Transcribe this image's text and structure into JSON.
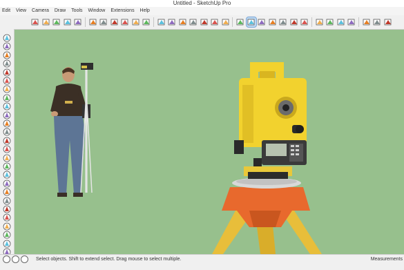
{
  "window": {
    "title": "Untitled - SketchUp Pro"
  },
  "menu": [
    "Edit",
    "View",
    "Camera",
    "Draw",
    "Tools",
    "Window",
    "Extensions",
    "Help"
  ],
  "toolbar": {
    "icons": [
      "select-icon",
      "paint-bucket-icon",
      "eraser-icon",
      "move-icon",
      "rotate-icon",
      "offset-icon",
      "push-pull-icon",
      "follow-me-icon",
      "orbit-icon",
      "pan-icon",
      "zoom-icon",
      "zoom-extents-icon",
      "iso-view-icon",
      "top-view-icon",
      "front-view-icon",
      "right-view-icon",
      "back-view-icon",
      "left-view-icon",
      "x-ray-icon",
      "back-edges-icon",
      "wireframe-icon",
      "hidden-line-icon",
      "shaded-icon",
      "textured-icon",
      "monochrome-icon",
      "cloud-icon",
      "cloud-download-icon",
      "cloud-upload-icon",
      "extension-warehouse-icon",
      "section-plane-icon",
      "section-display-icon",
      "section-cut-icon"
    ]
  },
  "left_toolbar": {
    "icons": [
      "select-icon",
      "eraser-icon",
      "line-icon",
      "freehand-icon",
      "rectangle-icon",
      "circle-icon",
      "arc-icon",
      "polygon-icon",
      "move-icon",
      "push-pull-icon",
      "rotate-icon",
      "scale-icon",
      "follow-me-icon",
      "offset-icon",
      "tape-measure-icon",
      "dimension-icon",
      "protractor-icon",
      "text-icon",
      "axes-icon",
      "3d-text-icon",
      "paint-bucket-icon",
      "orbit-icon",
      "pan-icon",
      "zoom-icon",
      "walk-icon",
      "position-camera-icon"
    ]
  },
  "viewport": {
    "background_color": "#97c08d",
    "scene_objects": [
      "surveyor-person-figure",
      "total-station-instrument",
      "tripod"
    ]
  },
  "status": {
    "message": "Select objects. Shift to extend select. Drag mouse to select multiple.",
    "measurements_label": "Measurements"
  }
}
